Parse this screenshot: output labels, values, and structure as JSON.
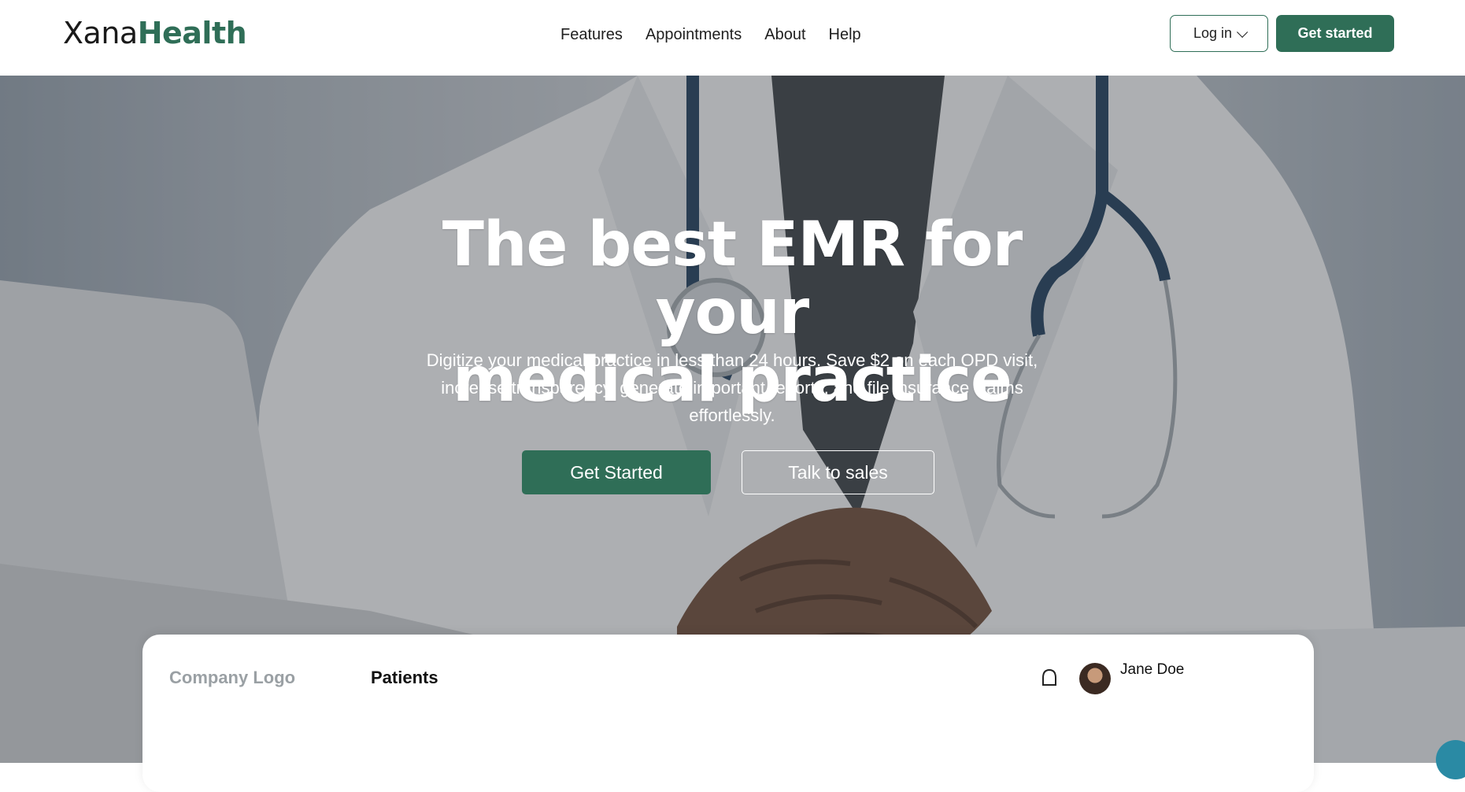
{
  "brand": {
    "logo_light": "Xana",
    "logo_bold": "Health"
  },
  "nav": {
    "items": [
      "Features",
      "Appointments",
      "About",
      "Help"
    ]
  },
  "header_actions": {
    "login_label": "Log in",
    "get_started_label": "Get started"
  },
  "hero": {
    "headline_line1": "The best EMR for your",
    "headline_line2": "medical practice",
    "subtext": "Digitize your medical practice in less than 24 hours. Save $2 on each OPD visit, increase transparency, generate important reports, and file insurance claims effortlessly.",
    "primary_cta": "Get Started",
    "secondary_cta": "Talk to sales"
  },
  "preview": {
    "company_logo": "Company Logo",
    "section_title": "Patients",
    "user_name": "Jane Doe"
  },
  "colors": {
    "brand_green": "#2f6e57",
    "white": "#ffffff",
    "text_dark": "#1f1f1f"
  },
  "icons": {
    "login_chevron": "chevron-down-icon",
    "bell": "bell-icon",
    "avatar": "avatar",
    "chat": "chat-icon"
  }
}
